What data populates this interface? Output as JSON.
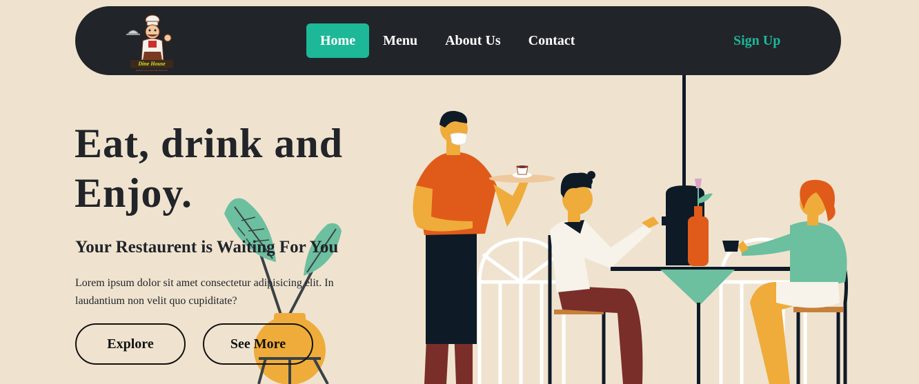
{
  "logo": {
    "name": "Dine House",
    "tagline": "Refresh your mood with tasty food",
    "icon": "chef-mascot-icon"
  },
  "nav": {
    "items": [
      {
        "label": "Home",
        "active": true
      },
      {
        "label": "Menu",
        "active": false
      },
      {
        "label": "About Us",
        "active": false
      },
      {
        "label": "Contact",
        "active": false
      }
    ],
    "signup_label": "Sign Up"
  },
  "hero": {
    "title_line1": "Eat, drink and",
    "title_line2": "Enjoy.",
    "subtitle": "Your Restaurent is Waiting For You",
    "text": "Lorem ipsum dolor sit amet consectetur adipisicing elit. In laudantium non velit quo cupiditate?",
    "explore_label": "Explore",
    "see_more_label": "See More"
  },
  "illustration": {
    "name": "restaurant-scene-illustration",
    "decor": "potted-plant-illustration"
  },
  "colors": {
    "background": "#efe3cf",
    "navbar": "#212429",
    "accent": "#1db898",
    "text": "#212429"
  }
}
